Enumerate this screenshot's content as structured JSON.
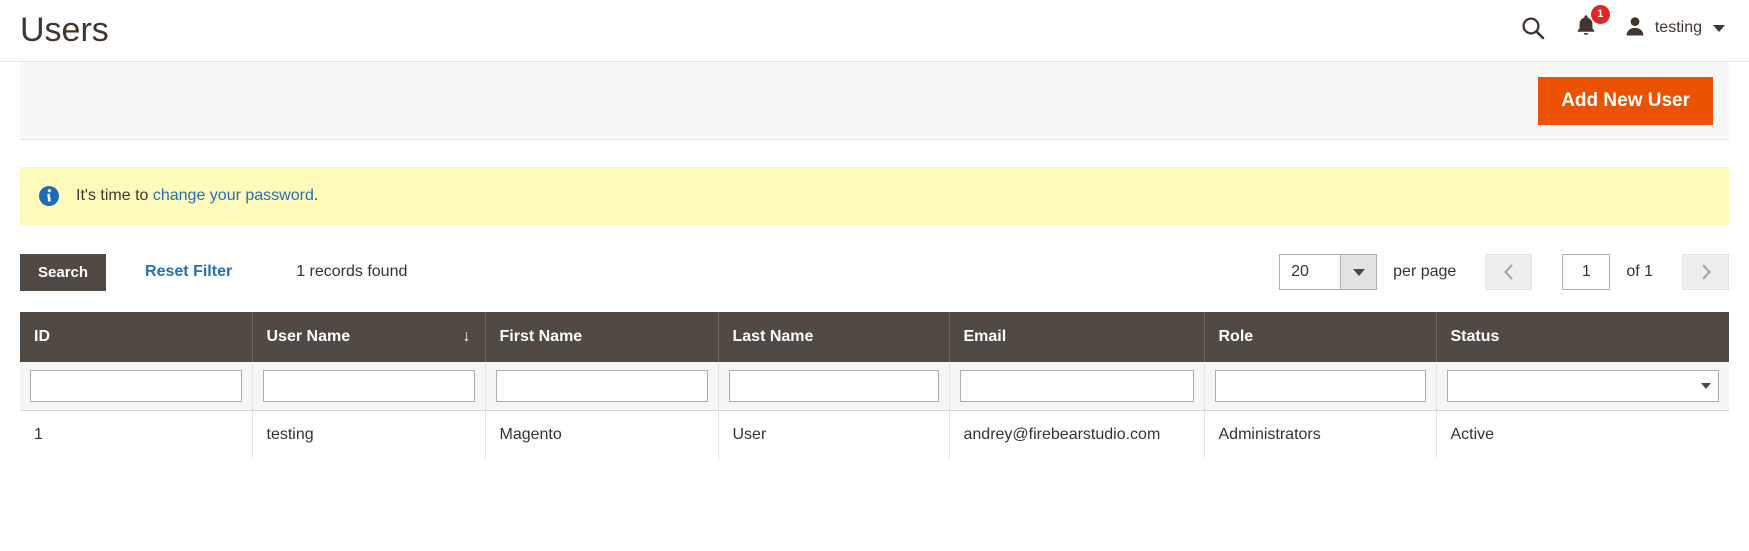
{
  "header": {
    "title": "Users",
    "search_icon": "search-icon",
    "notifications_icon": "bell-icon",
    "notifications_count": "1",
    "user_icon": "user-avatar-icon",
    "user_name": "testing",
    "caret_icon": "chevron-down-icon"
  },
  "page_actions": {
    "add_new_user_label": "Add New User",
    "accent_color": "#eb5202"
  },
  "message": {
    "icon": "info-icon",
    "text_before": "It's time to ",
    "link_label": "change your password",
    "text_after": ".",
    "background_color": "#fffbbb",
    "link_color": "#2370b3"
  },
  "toolbar": {
    "search_label": "Search",
    "reset_filter_label": "Reset Filter",
    "records_found": "1 records found",
    "per_page_value": "20",
    "per_page_label": "per page",
    "prev_page_icon": "chevron-left-icon",
    "next_page_icon": "chevron-right-icon",
    "current_page": "1",
    "of_pages": "of 1",
    "search_button_color": "#514943"
  },
  "grid": {
    "columns": [
      {
        "label": "ID",
        "sorted": false,
        "sort_icon": "",
        "filter_type": "text",
        "filter_value": ""
      },
      {
        "label": "User Name",
        "sorted": true,
        "sort_icon": "↓",
        "filter_type": "text",
        "filter_value": ""
      },
      {
        "label": "First Name",
        "sorted": false,
        "sort_icon": "",
        "filter_type": "text",
        "filter_value": ""
      },
      {
        "label": "Last Name",
        "sorted": false,
        "sort_icon": "",
        "filter_type": "text",
        "filter_value": ""
      },
      {
        "label": "Email",
        "sorted": false,
        "sort_icon": "",
        "filter_type": "text",
        "filter_value": ""
      },
      {
        "label": "Role",
        "sorted": false,
        "sort_icon": "",
        "filter_type": "text",
        "filter_value": ""
      },
      {
        "label": "Status",
        "sorted": false,
        "sort_icon": "",
        "filter_type": "select",
        "filter_value": ""
      }
    ],
    "rows": [
      {
        "id": "1",
        "user_name": "testing",
        "first_name": "Magento",
        "last_name": "User",
        "email": "andrey@firebearstudio.com",
        "role": "Administrators",
        "status": "Active"
      }
    ],
    "header_background": "#514943"
  }
}
